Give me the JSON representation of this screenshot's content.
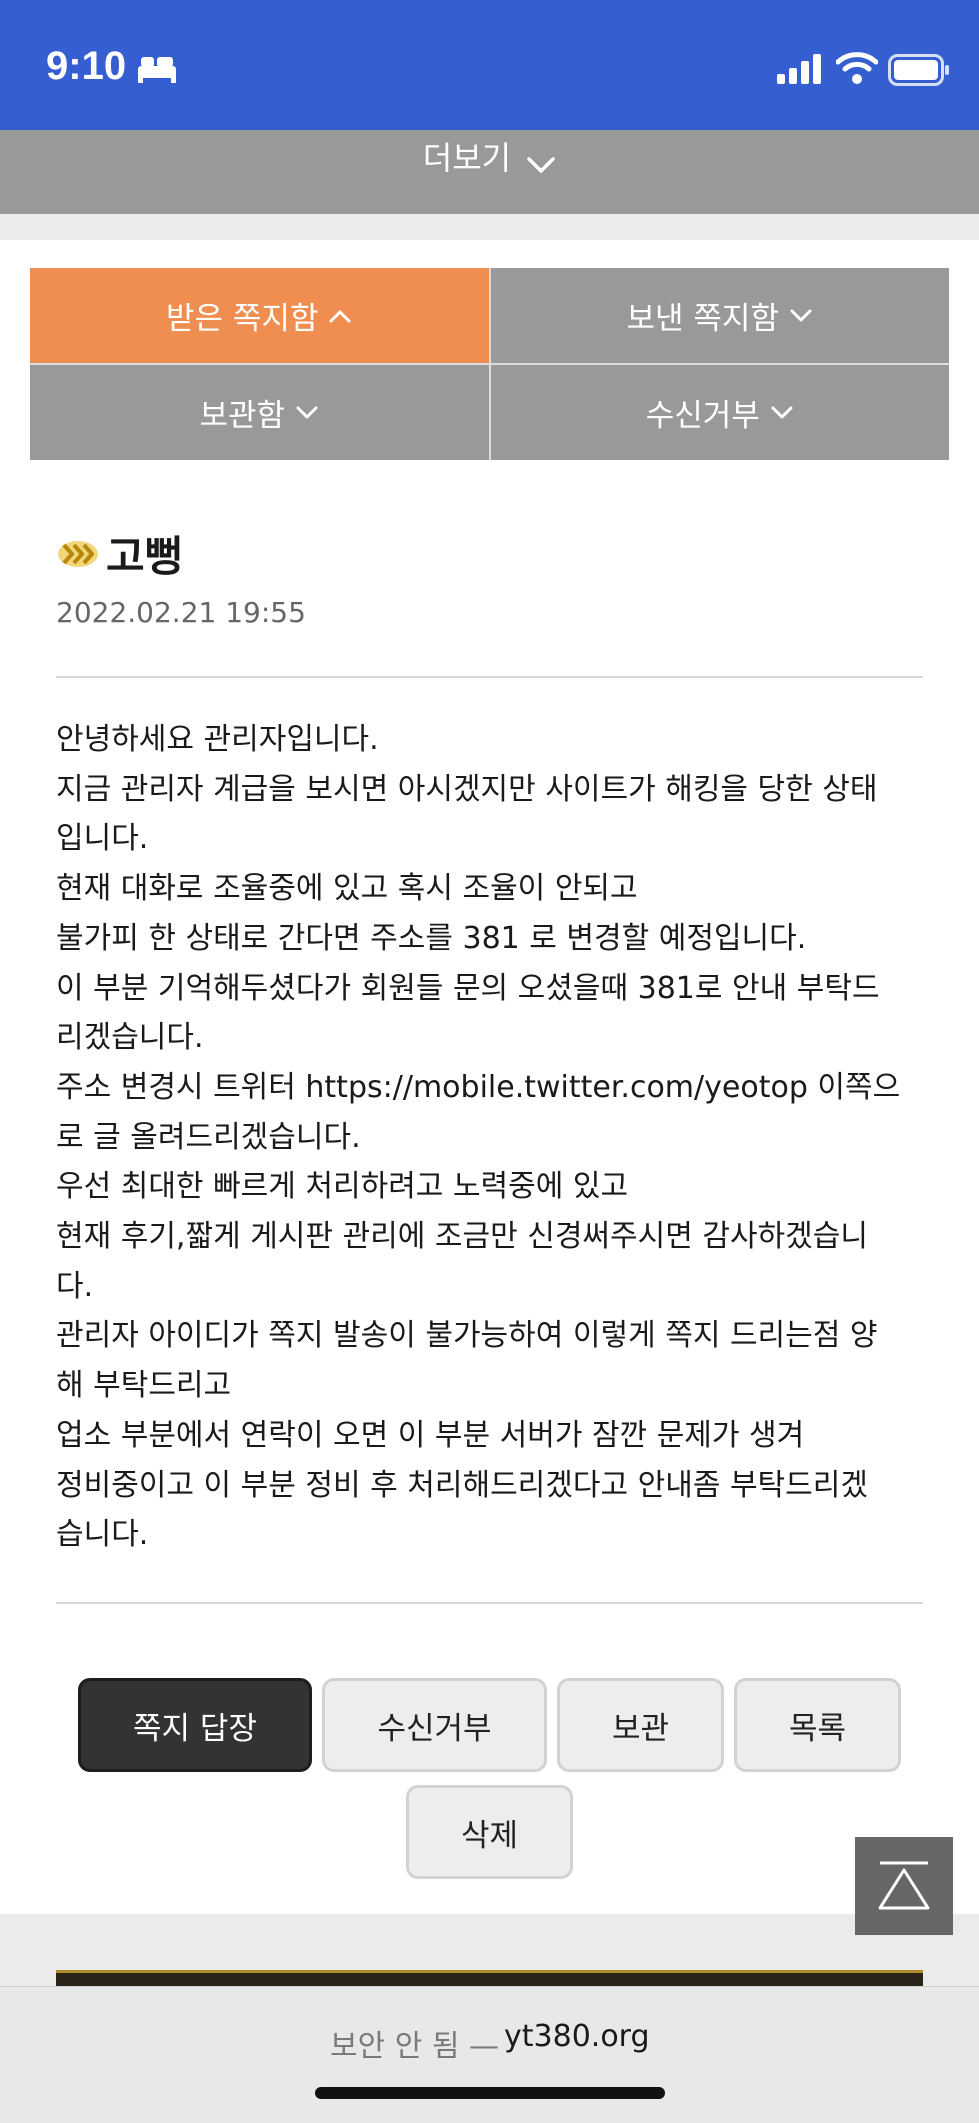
{
  "status_bar": {
    "time": "9:10",
    "icons": [
      "bed-icon",
      "cellular-signal-icon",
      "wifi-icon",
      "battery-icon"
    ],
    "background": "#355fd0"
  },
  "more_bar": {
    "label": "더보기"
  },
  "tabs": [
    {
      "label": "받은 쪽지함",
      "active": true
    },
    {
      "label": "보낸 쪽지함",
      "active": false
    },
    {
      "label": "보관함",
      "active": false
    },
    {
      "label": "수신거부",
      "active": false
    }
  ],
  "message": {
    "sender": "고뻥",
    "date": "2022.02.21 19:55",
    "lines": [
      "안녕하세요 관리자입니다.",
      "지금 관리자 계급을 보시면 아시겠지만 사이트가 해킹을 당한 상태",
      "입니다.",
      "현재 대화로 조율중에 있고 혹시 조율이 안되고",
      "불가피 한 상태로 간다면 주소를 381 로 변경할 예정입니다.",
      "이 부분 기억해두셨다가 회원들 문의 오셨을때 381로 안내 부탁드",
      "리겠습니다.",
      "주소 변경시 트위터 https://mobile.twitter.com/yeotop 이쪽으",
      "로 글 올려드리겠습니다.",
      "우선 최대한 빠르게 처리하려고 노력중에 있고",
      "현재 후기,짧게 게시판 관리에 조금만 신경써주시면 감사하겠습니",
      "다.",
      "관리자 아이디가 쪽지 발송이 불가능하여 이렇게 쪽지 드리는점 양",
      "해 부탁드리고",
      "업소 부분에서 연락이 오면 이 부분 서버가 잠깐 문제가 생겨",
      "정비중이고 이 부분 정비 후 처리해드리겠다고 안내좀 부탁드리겠",
      "습니다."
    ]
  },
  "actions": {
    "reply": "쪽지 답장",
    "block": "수신거부",
    "archive": "보관",
    "list": "목록",
    "delete": "삭제"
  },
  "url_bar": {
    "security_label": "보안 안 됨 —",
    "domain": "yt380.org"
  },
  "colors": {
    "active_tab": "#f08e52",
    "inactive_tab": "#999999",
    "primary_button": "#333333"
  }
}
